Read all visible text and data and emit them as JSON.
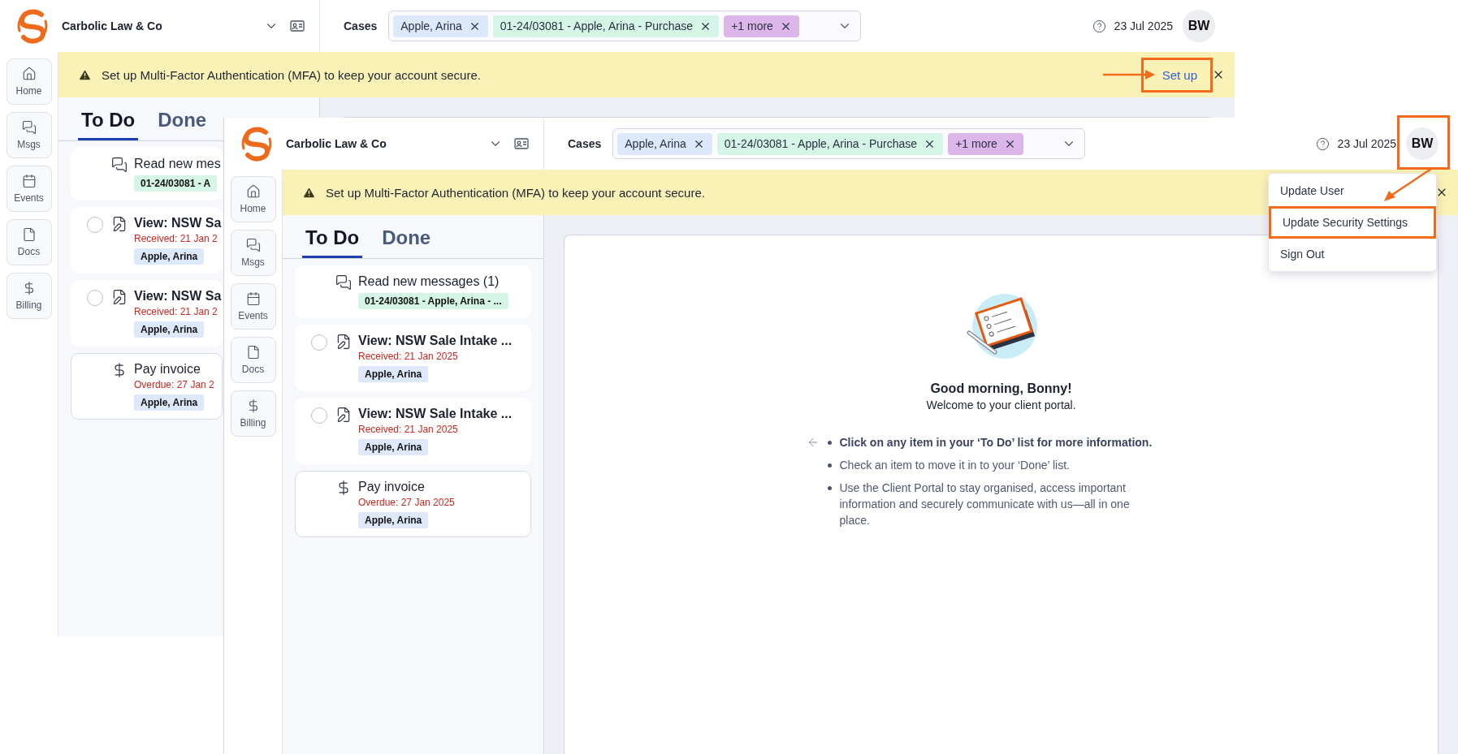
{
  "windows": [
    {
      "brand": {
        "name": "Carbolic Law & Co"
      },
      "cases": {
        "label": "Cases",
        "chips": [
          {
            "text": "Apple, Arina",
            "color": "#dde8fb"
          },
          {
            "text": "01-24/03081 - Apple, Arina - Purchase",
            "color": "#d5f5e6"
          },
          {
            "text": "+1 more",
            "color": "#dcb6e8"
          }
        ]
      },
      "date": "23 Jul 2025",
      "avatar": "BW",
      "banner": {
        "text": "Set up Multi-Factor Authentication (MFA) to keep your account secure.",
        "action": "Set up"
      },
      "nav": [
        {
          "kind": "home",
          "label": "Home"
        },
        {
          "kind": "messages",
          "label": "Msgs"
        },
        {
          "kind": "events",
          "label": "Events"
        },
        {
          "kind": "docs",
          "label": "Docs"
        },
        {
          "kind": "billing",
          "label": "Billing"
        }
      ],
      "tabs": [
        {
          "label": "To Do",
          "selected": true
        },
        {
          "label": "Done",
          "selected": false
        }
      ],
      "todo": [
        {
          "kind": "message",
          "title": "Read new mes",
          "tags": [
            {
              "text": "01-24/03081 - A",
              "color": "#d5f5e6"
            }
          ]
        },
        {
          "kind": "form",
          "checked": false,
          "title": "View: NSW Sa",
          "status": "Received: 21 Jan 2",
          "tags": [
            {
              "text": "Apple, Arina",
              "color": "#dde8fb"
            }
          ]
        },
        {
          "kind": "form",
          "checked": false,
          "title": "View: NSW Sa",
          "status": "Received: 21 Jan 2",
          "tags": [
            {
              "text": "Apple, Arina",
              "color": "#dde8fb"
            }
          ]
        },
        {
          "kind": "invoice",
          "title": "Pay invoice",
          "status": "Overdue: 27 Jan 2",
          "tags": [
            {
              "text": "Apple, Arina",
              "color": "#dde8fb"
            }
          ]
        }
      ]
    },
    {
      "brand": {
        "name": "Carbolic Law & Co"
      },
      "cases": {
        "label": "Cases",
        "chips": [
          {
            "text": "Apple, Arina",
            "color": "#dde8fb"
          },
          {
            "text": "01-24/03081 - Apple, Arina - Purchase",
            "color": "#d5f5e6"
          },
          {
            "text": "+1 more",
            "color": "#dcb6e8"
          }
        ]
      },
      "date": "23 Jul 2025",
      "avatar": "BW",
      "banner": {
        "text": "Set up Multi-Factor Authentication (MFA) to keep your account secure."
      },
      "nav": [
        {
          "kind": "home",
          "label": "Home"
        },
        {
          "kind": "messages",
          "label": "Msgs"
        },
        {
          "kind": "events",
          "label": "Events"
        },
        {
          "kind": "docs",
          "label": "Docs"
        },
        {
          "kind": "billing",
          "label": "Billing"
        }
      ],
      "tabs": [
        {
          "label": "To Do",
          "selected": true
        },
        {
          "label": "Done",
          "selected": false
        }
      ],
      "todo": [
        {
          "kind": "message",
          "title": "Read new messages (1)",
          "tags": [
            {
              "text": "01-24/03081 - Apple, Arina - ...",
              "color": "#d5f5e6"
            }
          ]
        },
        {
          "kind": "form",
          "checked": false,
          "title": "View: NSW Sale Intake ...",
          "status": "Received: 21 Jan 2025",
          "tags": [
            {
              "text": "Apple, Arina",
              "color": "#dde8fb"
            }
          ]
        },
        {
          "kind": "form",
          "checked": false,
          "title": "View: NSW Sale Intake ...",
          "status": "Received: 21 Jan 2025",
          "tags": [
            {
              "text": "Apple, Arina",
              "color": "#dde8fb"
            }
          ]
        },
        {
          "kind": "invoice",
          "title": "Pay invoice",
          "status": "Overdue: 27 Jan 2025",
          "tags": [
            {
              "text": "Apple, Arina",
              "color": "#dde8fb"
            }
          ]
        }
      ],
      "welcome": {
        "title": "Good morning, Bonny!",
        "subtitle": "Welcome to your client portal.",
        "tips": [
          {
            "text": "Click on any item in your ‘To Do’ list for more information.",
            "bold": true
          },
          {
            "text": "Check an item to move it in to your ‘Done’ list.",
            "bold": false
          },
          {
            "text": "Use the Client Portal to stay organised, access important information and securely communicate with us—all in one place.",
            "bold": false
          }
        ]
      },
      "user_menu": [
        {
          "label": "Update User",
          "annotated": false
        },
        {
          "label": "Update Security Settings",
          "annotated": true
        },
        {
          "label": "Sign Out",
          "annotated": false
        }
      ]
    }
  ]
}
